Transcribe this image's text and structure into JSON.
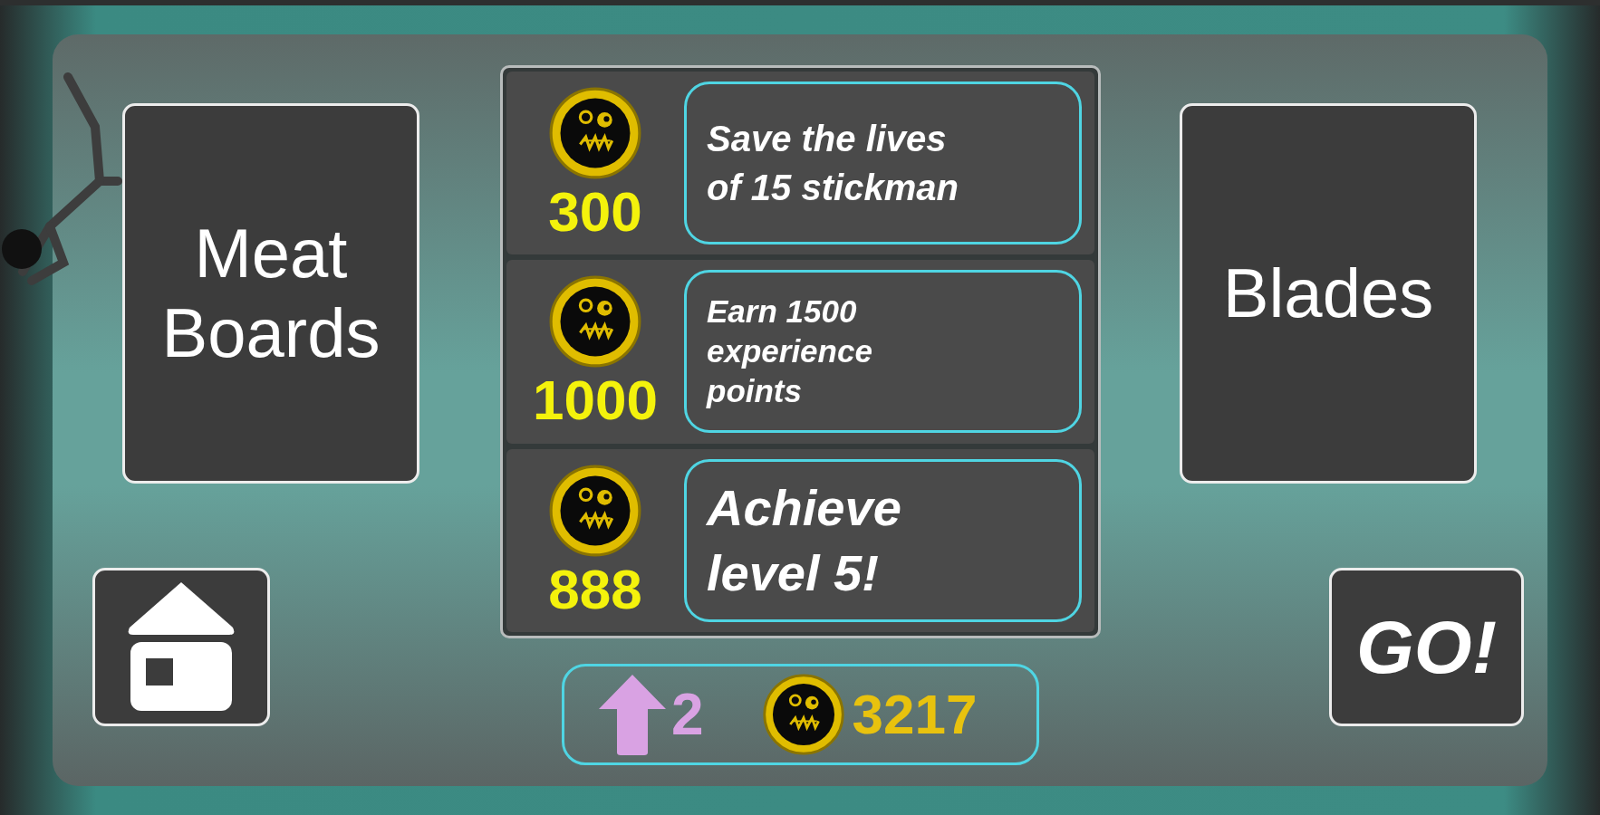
{
  "left_button": {
    "label": "Meat\nBoards"
  },
  "right_button": {
    "label": "Blades"
  },
  "quests": [
    {
      "reward": "300",
      "description": "Save the lives\nof 15 stickman"
    },
    {
      "reward": "1000",
      "description": "Earn 1500\nexperience\npoints"
    },
    {
      "reward": "888",
      "description": "Achieve\nlevel 5!"
    }
  ],
  "status": {
    "level": "2",
    "coins": "3217"
  },
  "go_button": {
    "label": "GO!"
  }
}
